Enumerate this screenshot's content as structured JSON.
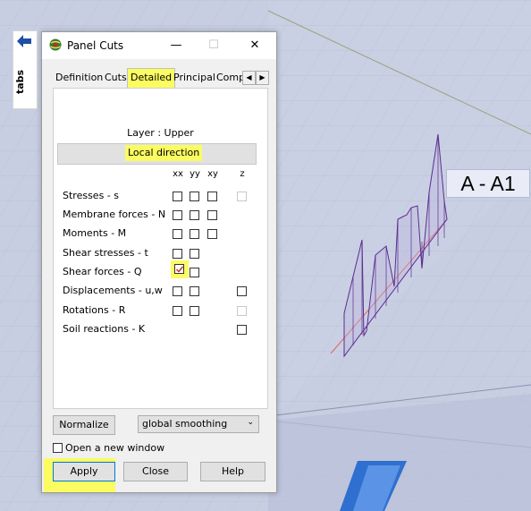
{
  "sidebar": {
    "tabs_label": "tabs",
    "arrow_icon": "arrow-left-icon",
    "accent": "#1f4fa3"
  },
  "canvas": {
    "section_label": "A - A1"
  },
  "dialog": {
    "title": "Panel Cuts",
    "app_icon": "globe-app-icon",
    "minimize_glyph": "—",
    "maximize_glyph": "☐",
    "close_glyph": "✕",
    "tabs": [
      "Definition",
      "Cuts",
      "Detailed",
      "Principal",
      "Comp"
    ],
    "active_tab": "Detailed",
    "tab_prev_glyph": "◀",
    "tab_next_glyph": "▶",
    "layer_label": "Layer : Upper",
    "local_direction_label": "Local direction",
    "columns": [
      "xx",
      "yy",
      "xy",
      "z"
    ],
    "rows": [
      {
        "label": "Stresses - s",
        "xx": false,
        "yy": false,
        "xy": false,
        "z": "disabled"
      },
      {
        "label": "Membrane forces - N",
        "xx": false,
        "yy": false,
        "xy": false,
        "z": null
      },
      {
        "label": "Moments - M",
        "xx": false,
        "yy": false,
        "xy": false,
        "z": null
      },
      {
        "label": "Shear stresses - t",
        "xx": false,
        "yy": false,
        "xy": null,
        "z": null
      },
      {
        "label": "Shear forces - Q",
        "xx": true,
        "yy": false,
        "xy": null,
        "z": null
      },
      {
        "label": "Displacements - u,w",
        "xx": false,
        "yy": false,
        "xy": null,
        "z": false
      },
      {
        "label": "Rotations - R",
        "xx": false,
        "yy": false,
        "xy": null,
        "z": "disabled"
      },
      {
        "label": "Soil reactions - K",
        "xx": null,
        "yy": null,
        "xy": null,
        "z": false
      }
    ],
    "normalize_label": "Normalize",
    "smoothing_value": "global smoothing",
    "open_new_window_label": "Open a new window",
    "open_new_window_checked": false,
    "apply_label": "Apply",
    "close_label": "Close",
    "help_label": "Help",
    "highlight_color": "#fbfb62"
  }
}
